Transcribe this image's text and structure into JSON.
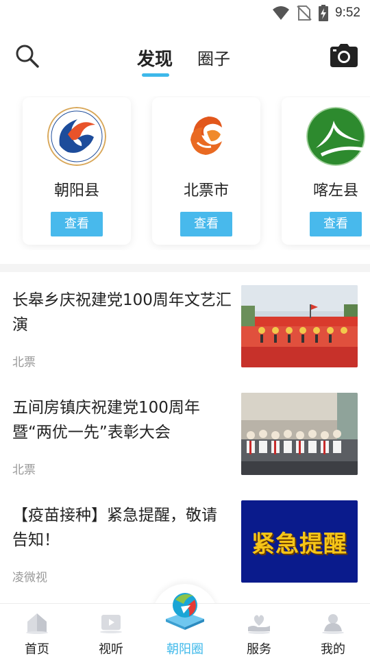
{
  "status_bar": {
    "time": "9:52",
    "icons": [
      "wifi-icon",
      "no-sim-icon",
      "battery-charging-icon"
    ]
  },
  "header": {
    "tabs": [
      {
        "label": "发现",
        "active": true
      },
      {
        "label": "圈子",
        "active": false
      }
    ],
    "accent": "#3db8ea"
  },
  "circles": [
    {
      "name": "朝阳县",
      "button": "查看",
      "logo": "chaoyang-county-logo"
    },
    {
      "name": "北票市",
      "button": "查看",
      "logo": "beipiao-phoenix-logo"
    },
    {
      "name": "喀左县",
      "button": "查看",
      "logo": "kazuo-green-logo"
    }
  ],
  "news": [
    {
      "title": "长皋乡庆祝建党100周年文艺汇演",
      "source": "北票",
      "thumb": "stage-performance-photo"
    },
    {
      "title": "五间房镇庆祝建党100周年暨“两优一先”表彰大会",
      "source": "北票",
      "thumb": "meeting-hall-photo"
    },
    {
      "title": "【疫苗接种】紧急提醒，敬请告知！",
      "source": "凌微视",
      "thumb": "urgent-notice-banner",
      "thumb_text": "紧急提醒"
    }
  ],
  "bottom_nav": [
    {
      "label": "首页",
      "icon": "home-icon",
      "active": false
    },
    {
      "label": "视听",
      "icon": "video-icon",
      "active": false
    },
    {
      "label": "朝阳圈",
      "icon": "chaoyang-circle-icon",
      "active": true
    },
    {
      "label": "服务",
      "icon": "service-icon",
      "active": false
    },
    {
      "label": "我的",
      "icon": "profile-icon",
      "active": false
    }
  ]
}
